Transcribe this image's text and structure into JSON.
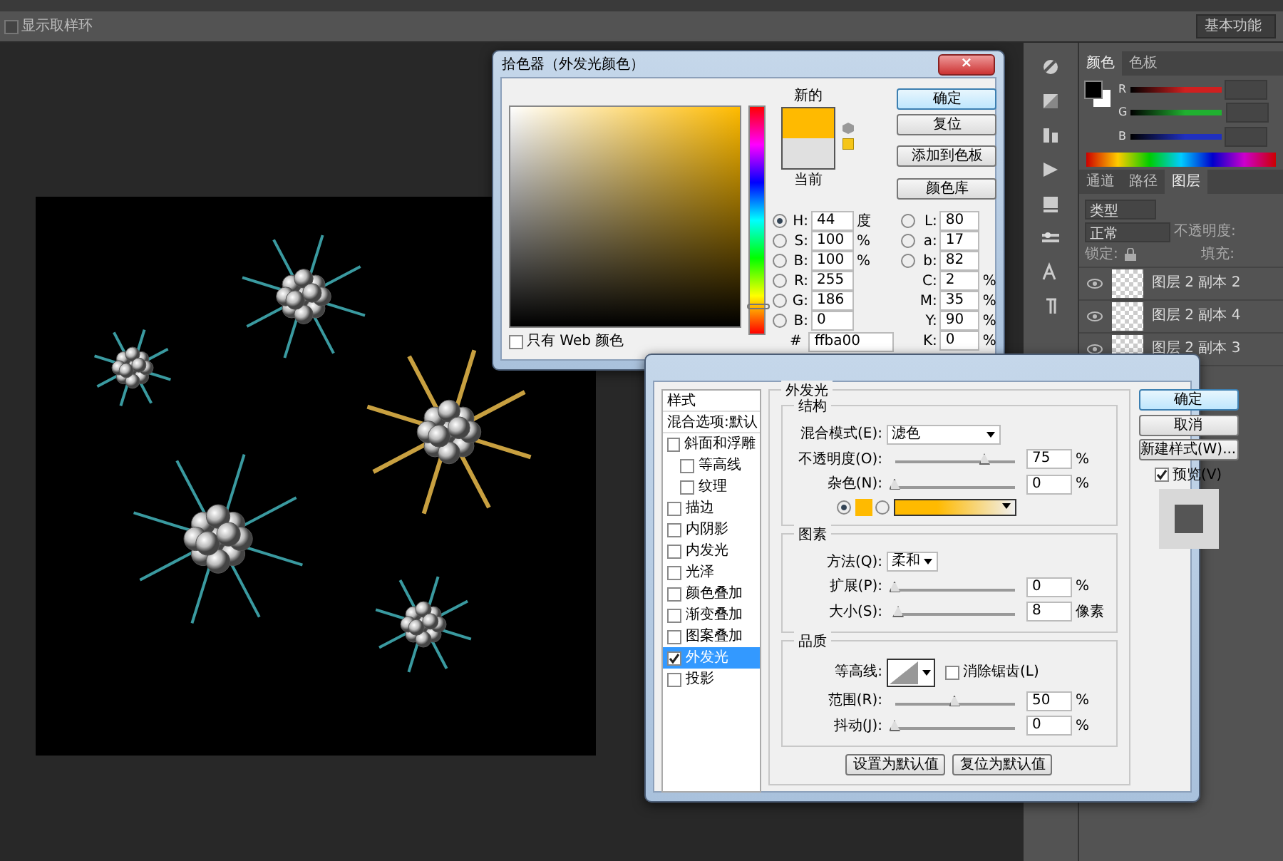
{
  "options_bar": {
    "sample_ring": {
      "label": "显示取样环",
      "checked": false
    },
    "workspace": "基本功能"
  },
  "color_panel": {
    "tabs": [
      {
        "label": "颜色",
        "selected": true
      },
      {
        "label": "色板",
        "selected": false
      }
    ],
    "channels": [
      {
        "label": "R",
        "color": "#d02020"
      },
      {
        "label": "G",
        "color": "#20b030"
      },
      {
        "label": "B",
        "color": "#2030c0"
      }
    ]
  },
  "layers_panel": {
    "tabs": [
      {
        "label": "通道",
        "selected": false
      },
      {
        "label": "路径",
        "selected": false
      },
      {
        "label": "图层",
        "selected": true
      }
    ],
    "filter": "类型",
    "blend_mode": "正常",
    "opacity_label": "不透明度:",
    "lock_label": "锁定:",
    "fill_label": "填充:",
    "layers": [
      {
        "name": "图层 2 副本 2",
        "visible": true
      },
      {
        "name": "图层 2 副本 4",
        "visible": true
      },
      {
        "name": "图层 2 副本 3",
        "visible": true
      }
    ]
  },
  "color_picker": {
    "title": "拾色器（外发光颜色）",
    "close": "×",
    "hue_slider": {
      "level": 0.12
    },
    "new_label": "新的",
    "current_label": "当前",
    "buttons": [
      "确定",
      "复位",
      "添加到色板",
      "颜色库"
    ],
    "left_fields": [
      {
        "kind": "radio",
        "label": "H:",
        "value": "44",
        "unit": "度",
        "selected": true
      },
      {
        "kind": "radio",
        "label": "S:",
        "value": "100",
        "unit": "%",
        "selected": false
      },
      {
        "kind": "radio",
        "label": "B:",
        "value": "100",
        "unit": "%",
        "selected": false
      },
      {
        "kind": "radio",
        "label": "R:",
        "value": "255",
        "selected": false
      },
      {
        "kind": "radio",
        "label": "G:",
        "value": "186",
        "selected": false
      },
      {
        "kind": "radio",
        "label": "B:",
        "value": "0",
        "selected": false
      }
    ],
    "right_fields": [
      {
        "kind": "radio",
        "label": "L:",
        "value": "80",
        "selected": false
      },
      {
        "kind": "radio",
        "label": "a:",
        "value": "17",
        "selected": false
      },
      {
        "kind": "radio",
        "label": "b:",
        "value": "82",
        "selected": false
      },
      {
        "kind": "plain",
        "label": "C:",
        "value": "2",
        "unit": "%"
      },
      {
        "kind": "plain",
        "label": "M:",
        "value": "35",
        "unit": "%"
      },
      {
        "kind": "plain",
        "label": "Y:",
        "value": "90",
        "unit": "%"
      },
      {
        "kind": "plain",
        "label": "K:",
        "value": "0",
        "unit": "%"
      }
    ],
    "hex_label": "#",
    "hex": "ffba00",
    "web_only": {
      "label": "只有 Web 颜色",
      "checked": false
    }
  },
  "layer_style": {
    "styles": [
      {
        "label": "样式",
        "kind": "header",
        "selected": false
      },
      {
        "label": "混合选项:默认",
        "kind": "header",
        "selected": false
      },
      {
        "label": "斜面和浮雕",
        "kind": "check",
        "checked": false,
        "selected": false
      },
      {
        "label": "等高线",
        "kind": "subcheck",
        "checked": false,
        "selected": false
      },
      {
        "label": "纹理",
        "kind": "subcheck",
        "checked": false,
        "selected": false
      },
      {
        "label": "描边",
        "kind": "check",
        "checked": false,
        "selected": false
      },
      {
        "label": "内阴影",
        "kind": "check",
        "checked": false,
        "selected": false
      },
      {
        "label": "内发光",
        "kind": "check",
        "checked": false,
        "selected": false
      },
      {
        "label": "光泽",
        "kind": "check",
        "checked": false,
        "selected": false
      },
      {
        "label": "颜色叠加",
        "kind": "check",
        "checked": false,
        "selected": false
      },
      {
        "label": "渐变叠加",
        "kind": "check",
        "checked": false,
        "selected": false
      },
      {
        "label": "图案叠加",
        "kind": "check",
        "checked": false,
        "selected": false
      },
      {
        "label": "外发光",
        "kind": "check",
        "checked": true,
        "selected": true
      },
      {
        "label": "投影",
        "kind": "check",
        "checked": false,
        "selected": false
      }
    ],
    "section_title": "外发光",
    "structure": {
      "title": "结构",
      "blend_label": "混合模式(E):",
      "blend_value": "滤色",
      "sliders": [
        {
          "label": "不透明度(O):",
          "level": 0.75,
          "value": "75",
          "unit": "%"
        },
        {
          "label": "杂色(N):",
          "level": 0,
          "value": "0",
          "unit": "%"
        }
      ],
      "fill": [
        {
          "kind": "color",
          "selected": true,
          "color": "#ffba00"
        },
        {
          "kind": "gradient",
          "selected": false,
          "color": "#ffba00"
        }
      ]
    },
    "elements": {
      "title": "图素",
      "method_label": "方法(Q):",
      "method_value": "柔和",
      "sliders": [
        {
          "label": "扩展(P):",
          "level": 0,
          "value": "0",
          "unit": "%"
        },
        {
          "label": "大小(S):",
          "level": 0.03,
          "value": "8",
          "unit": "像素"
        }
      ]
    },
    "quality": {
      "title": "品质",
      "contour_label": "等高线:",
      "anti_alias": {
        "label": "消除锯齿(L)",
        "checked": false
      },
      "sliders": [
        {
          "label": "范围(R):",
          "level": 0.5,
          "value": "50",
          "unit": "%"
        },
        {
          "label": "抖动(J):",
          "level": 0,
          "value": "0",
          "unit": "%"
        }
      ]
    },
    "bottom_buttons": [
      "设置为默认值",
      "复位为默认值"
    ],
    "buttons": [
      "确定",
      "取消",
      "新建样式(W)..."
    ],
    "preview": {
      "label": "预览(V)",
      "checked": true
    }
  }
}
